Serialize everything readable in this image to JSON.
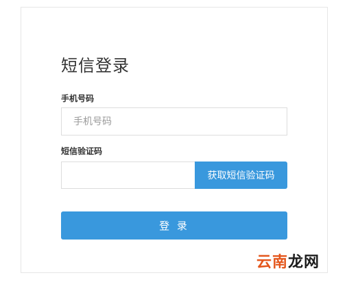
{
  "form": {
    "title": "短信登录",
    "phone": {
      "label": "手机号码",
      "placeholder": "手机号码",
      "value": ""
    },
    "code": {
      "label": "短信验证码",
      "placeholder": "",
      "value": "",
      "get_code_label": "获取短信验证码"
    },
    "login_label": "登 录"
  },
  "watermark": {
    "part1": "云南",
    "part2": "龙网"
  },
  "colors": {
    "accent": "#3998dd",
    "watermark_orange": "#e4561c",
    "watermark_dark": "#1c1c1c"
  }
}
